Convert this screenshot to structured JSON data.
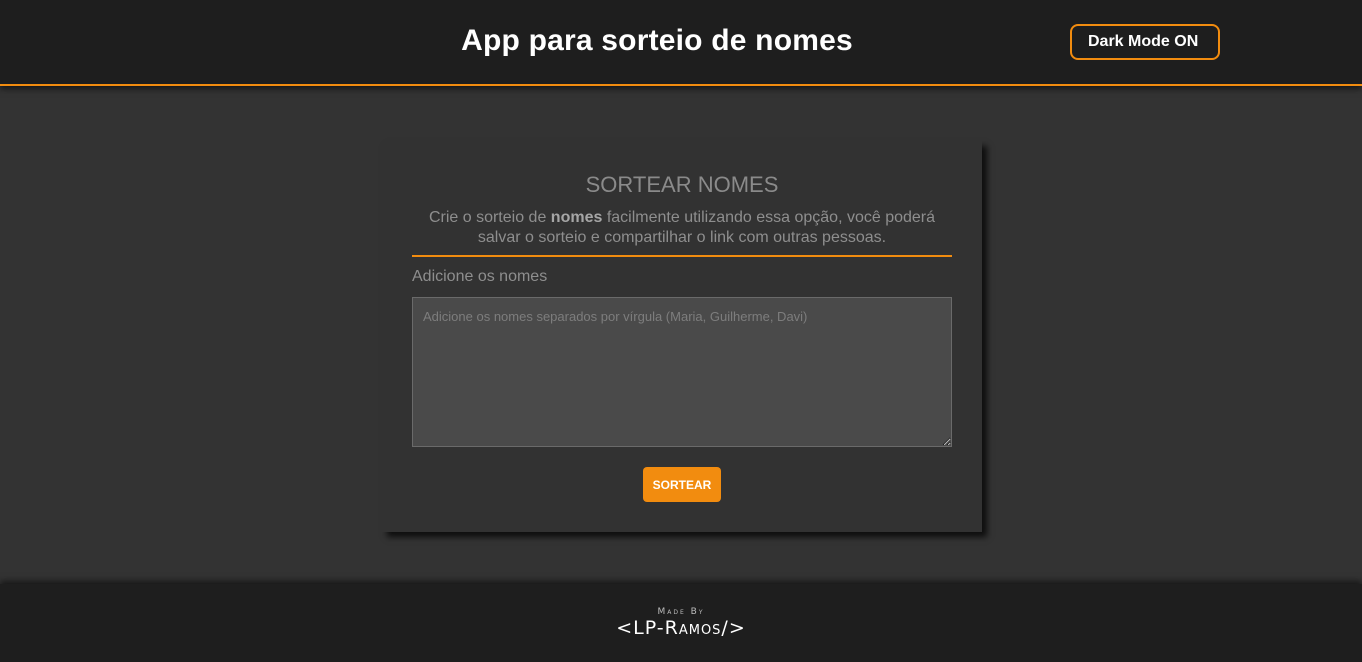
{
  "header": {
    "title": "App para sorteio de nomes",
    "dark_mode_label": "Dark Mode ON"
  },
  "card": {
    "title": "SORTEAR NOMES",
    "description_prefix": "Crie o sorteio de ",
    "description_bold": "nomes",
    "description_suffix": " facilmente utilizando essa opção, você poderá salvar o sorteio e compartilhar o link com outras pessoas.",
    "field_label": "Adicione os nomes",
    "input_value": "",
    "input_placeholder": "Adicione os nomes separados por vírgula (Maria, Guilherme, Davi)",
    "button_label": "SORTEAR"
  },
  "footer": {
    "made_by": "Made By",
    "author": "<LP-Ramos/>"
  },
  "colors": {
    "accent": "#f28c0f",
    "header_bg": "#1e1e1e",
    "page_bg": "#333333",
    "card_bg": "#323232",
    "input_bg": "#4a4a4a"
  }
}
